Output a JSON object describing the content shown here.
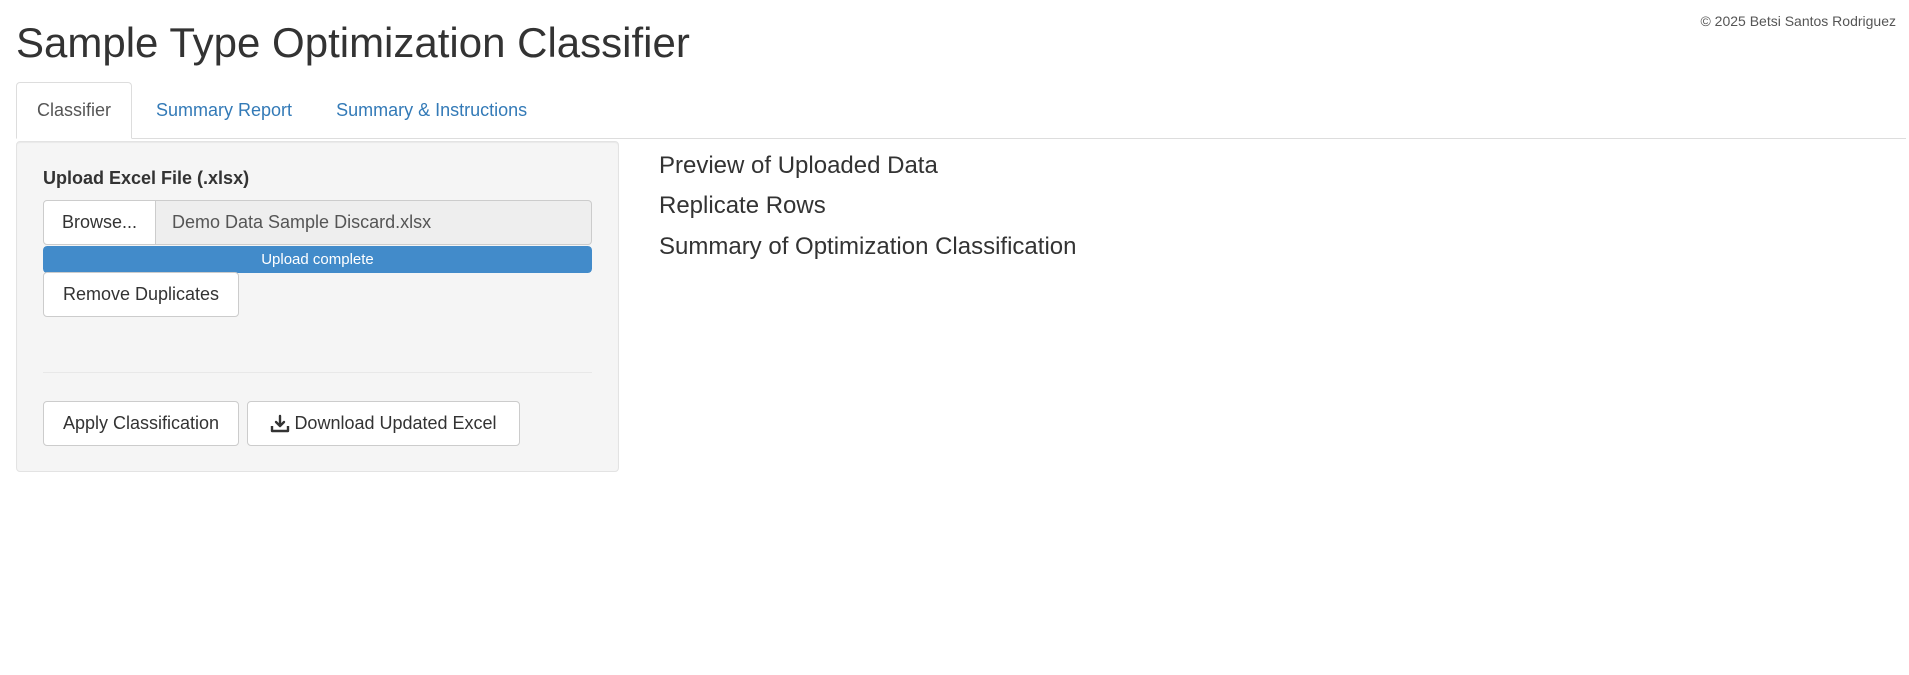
{
  "header": {
    "title": "Sample Type Optimization Classifier",
    "copyright": "© 2025 Betsi Santos Rodriguez"
  },
  "tabs": [
    {
      "label": "Classifier",
      "active": true
    },
    {
      "label": "Summary Report",
      "active": false
    },
    {
      "label": "Summary & Instructions",
      "active": false
    }
  ],
  "sidebar": {
    "upload_label": "Upload Excel File (.xlsx)",
    "browse_label": "Browse...",
    "file_name": "Demo Data Sample Discard.xlsx",
    "progress_text": "Upload complete",
    "progress_percent": 100,
    "remove_duplicates_label": "Remove Duplicates",
    "apply_classification_label": "Apply Classification",
    "download_label": "Download Updated Excel",
    "download_icon": "download-icon"
  },
  "main": {
    "headings": [
      "Preview of Uploaded Data",
      "Replicate Rows",
      "Summary of Optimization Classification"
    ]
  },
  "colors": {
    "accent": "#337ab7",
    "progress": "#428bca"
  }
}
